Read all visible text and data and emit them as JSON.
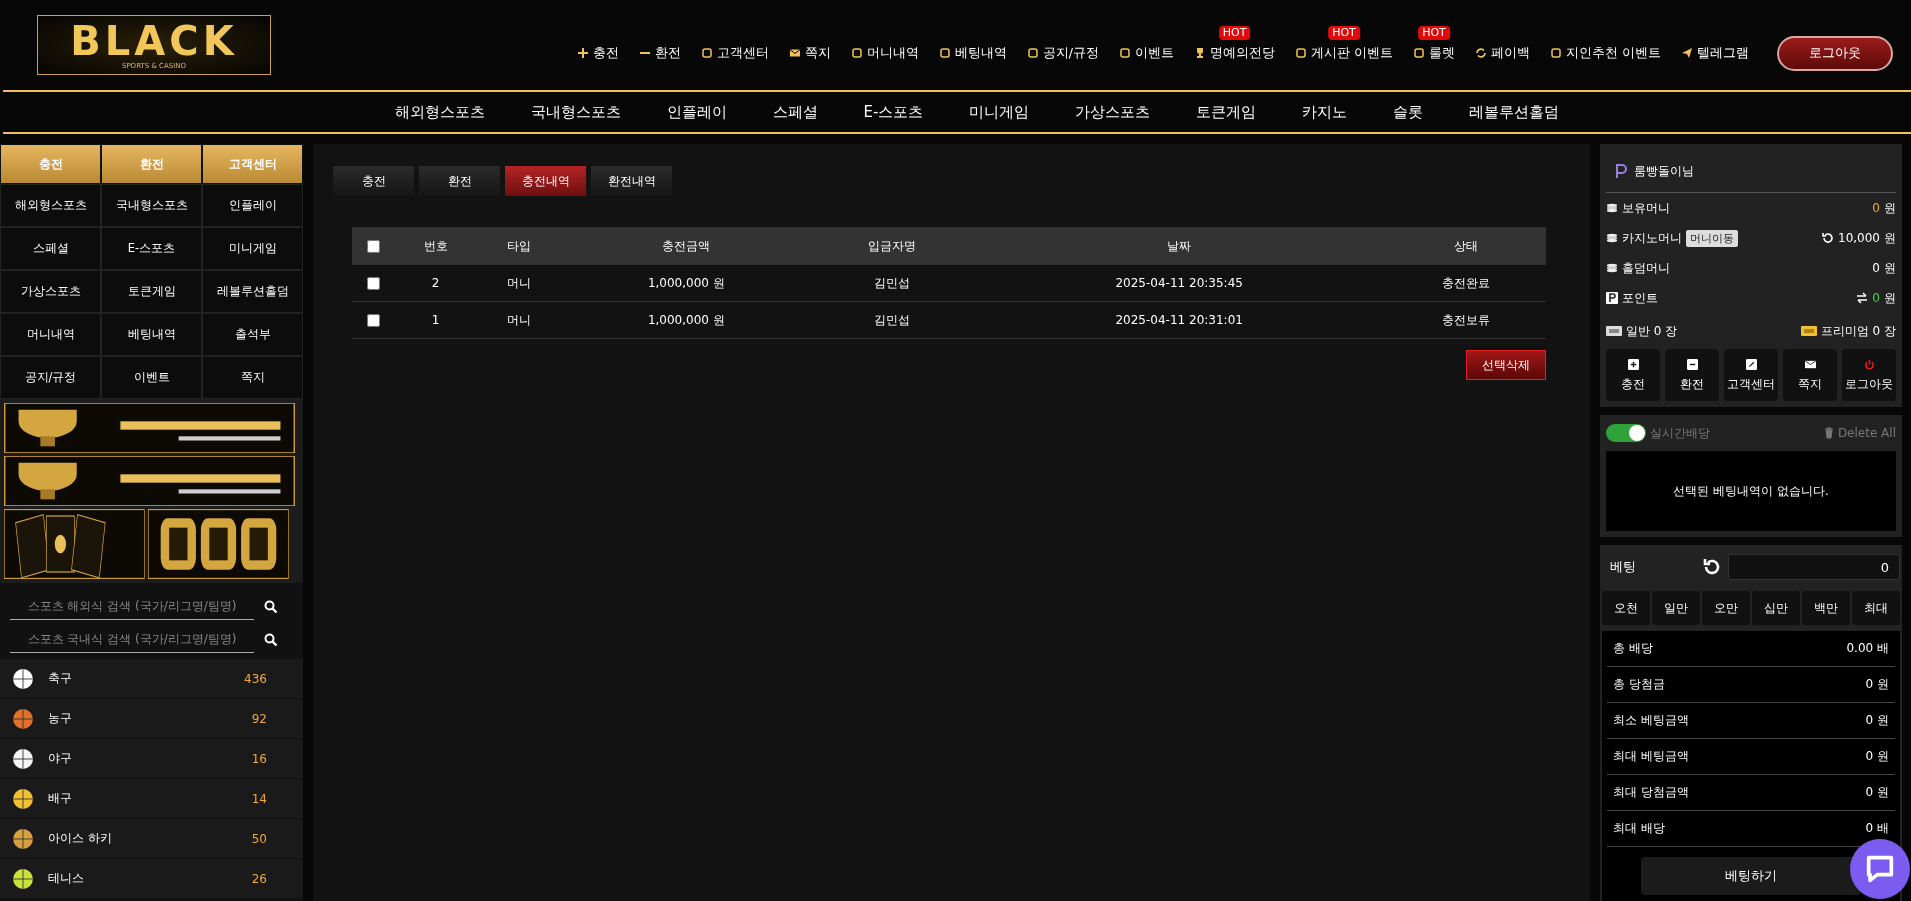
{
  "logo": {
    "name": "BLACK",
    "tagline": "SPORTS & CASINO"
  },
  "top_links": [
    {
      "label": "충전"
    },
    {
      "label": "환전"
    },
    {
      "label": "고객센터"
    },
    {
      "label": "쪽지"
    },
    {
      "label": "머니내역"
    },
    {
      "label": "베팅내역"
    },
    {
      "label": "공지/규정"
    },
    {
      "label": "이벤트"
    },
    {
      "label": "명예의전당",
      "badge": "HOT"
    },
    {
      "label": "게시판 이벤트",
      "badge": "HOT"
    },
    {
      "label": "룰렛",
      "badge": "HOT"
    },
    {
      "label": "페이백"
    },
    {
      "label": "지인추천 이벤트"
    },
    {
      "label": "텔레그램"
    }
  ],
  "logout_button": "로그아웃",
  "main_nav": [
    "해외형스포츠",
    "국내형스포츠",
    "인플레이",
    "스페셜",
    "E-스포츠",
    "미니게임",
    "가상스포츠",
    "토큰게임",
    "카지노",
    "슬롯",
    "레볼루션홀덤"
  ],
  "sidebar": {
    "quick_buttons": [
      "충전",
      "환전",
      "고객센터"
    ],
    "menu": [
      "해외형스포츠",
      "국내형스포츠",
      "인플레이",
      "스페셜",
      "E-스포츠",
      "미니게임",
      "가상스포츠",
      "토큰게임",
      "레볼루션홀덤",
      "머니내역",
      "베팅내역",
      "출석부",
      "공지/규정",
      "이벤트",
      "쪽지"
    ],
    "banners": [
      {
        "kind": "picture"
      },
      {
        "kind": "picture"
      },
      {
        "kind": "picture"
      },
      {
        "kind": "picture"
      }
    ],
    "search_fields": [
      {
        "placeholder": "스포츠 해외식 검색 (국가/리그명/팀명)"
      },
      {
        "placeholder": "스포츠 국내식 검색 (국가/리그명/팀명)"
      }
    ],
    "sports": [
      {
        "name": "축구",
        "count": "436"
      },
      {
        "name": "농구",
        "count": "92"
      },
      {
        "name": "야구",
        "count": "16"
      },
      {
        "name": "배구",
        "count": "14"
      },
      {
        "name": "아이스 하키",
        "count": "50"
      },
      {
        "name": "테니스",
        "count": "26"
      }
    ]
  },
  "content": {
    "tabs": [
      {
        "label": "충전",
        "selected": false
      },
      {
        "label": "환전",
        "selected": false
      },
      {
        "label": "충전내역",
        "selected": true
      },
      {
        "label": "환전내역",
        "selected": false
      }
    ],
    "table": {
      "header_checked": false,
      "columns": [
        "번호",
        "타입",
        "충전금액",
        "입금자명",
        "날짜",
        "상태"
      ],
      "rows": [
        {
          "checked": false,
          "cells": [
            "2",
            "머니",
            "1,000,000 원",
            "김민섭",
            "2025-04-11 20:35:45",
            "충전완료"
          ]
        },
        {
          "checked": false,
          "cells": [
            "1",
            "머니",
            "1,000,000 원",
            "김민섭",
            "2025-04-11 20:31:01",
            "충전보류"
          ]
        }
      ]
    },
    "delete_button": "선택삭제"
  },
  "account": {
    "user": "룸빵돌이님",
    "balances": [
      {
        "kind": "held",
        "label": "보유머니",
        "amount": "0",
        "unit": "원"
      },
      {
        "kind": "casino",
        "label": "카지노머니",
        "button": "머니이동",
        "amount": "10,000",
        "unit": "원"
      },
      {
        "kind": "plain",
        "label": "홀덤머니",
        "amount": "0",
        "unit": "원"
      },
      {
        "kind": "point",
        "label": "포인트",
        "amount": "0",
        "unit": "원"
      }
    ],
    "tickets": [
      {
        "label": "일반 0 장"
      },
      {
        "label": "프리미엄 0 장"
      }
    ],
    "actions": [
      "충전",
      "환전",
      "고객센터",
      "쪽지",
      "로그아웃"
    ]
  },
  "bet_slip": {
    "live_odds_on": true,
    "live_odds_label": "실시간배당",
    "delete_all": "Delete All",
    "empty_message": "선택된 베팅내역이 없습니다."
  },
  "betting": {
    "label": "베팅",
    "amount": "0",
    "quick_amounts": [
      "오천",
      "일만",
      "오만",
      "십만",
      "백만",
      "최대"
    ],
    "summary": [
      {
        "label": "총 배당",
        "value": "0.00 배"
      },
      {
        "label": "총 당첨금",
        "value": "0 원"
      },
      {
        "label": "최소 베팅금액",
        "value": "0 원"
      },
      {
        "label": "최대 베팅금액",
        "value": "0 원"
      },
      {
        "label": "최대 당첨금액",
        "value": "0 원"
      },
      {
        "label": "최대 배당",
        "value": "0 배"
      }
    ],
    "submit": "베팅하기"
  }
}
